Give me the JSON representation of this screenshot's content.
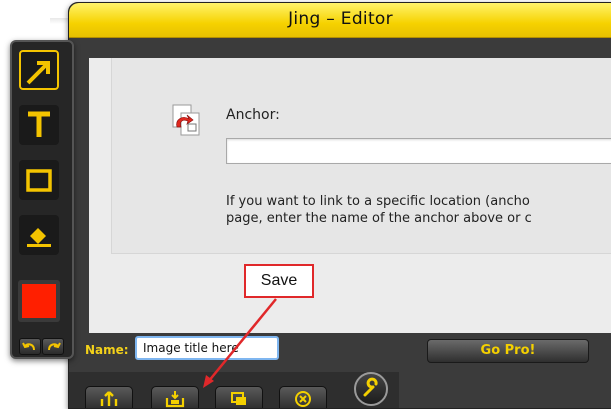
{
  "window": {
    "title": "Jing – Editor"
  },
  "content": {
    "anchor_label": "Anchor:",
    "anchor_value": "",
    "help_line1": "If you want to link to a specific location (ancho",
    "help_line2": "page, enter the name of the anchor above or c"
  },
  "footer": {
    "name_label": "Name:",
    "name_value": "Image title here",
    "gopro_label": "Go Pro!"
  },
  "callout": {
    "text": "Save"
  },
  "palette": {
    "tools": [
      "arrow-tool",
      "text-tool",
      "rectangle-tool",
      "highlighter-tool"
    ],
    "color": "#ff1f00"
  },
  "actions": [
    "share-button",
    "save-button",
    "copy-button",
    "cancel-button",
    "settings-button"
  ],
  "colors": {
    "accent": "#f4d000",
    "callout_border": "#e0282a"
  }
}
